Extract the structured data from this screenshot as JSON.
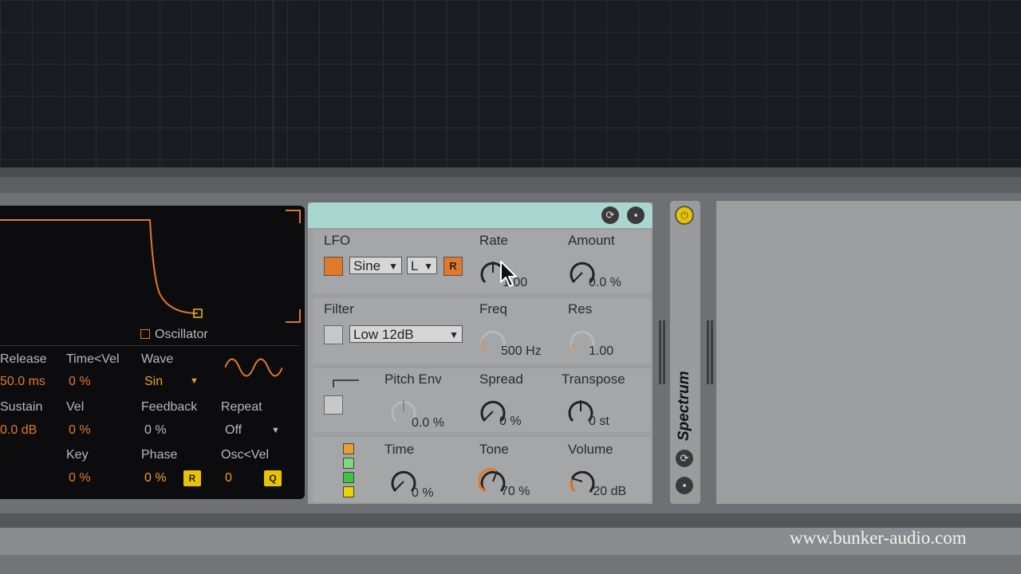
{
  "osc_panel": {
    "osc_label": "Oscillator",
    "release": {
      "label": "Release",
      "value": "50.0 ms"
    },
    "time_vel": {
      "label": "Time<Vel",
      "value": "0 %"
    },
    "wave": {
      "label": "Wave",
      "value": "Sin"
    },
    "sustain": {
      "label": "Sustain",
      "value": "0.0 dB"
    },
    "vel": {
      "label": "Vel",
      "value": "0 %"
    },
    "feedback": {
      "label": "Feedback",
      "value": "0 %"
    },
    "repeat": {
      "label": "Repeat",
      "value": "Off"
    },
    "key": {
      "label": "Key",
      "value": "0 %"
    },
    "phase": {
      "label": "Phase",
      "value": "0 %",
      "btn": "R"
    },
    "osc_vel": {
      "label": "Osc<Vel",
      "value": "0",
      "btn": "Q"
    }
  },
  "lfo": {
    "title": "LFO",
    "wave_select": "Sine",
    "range_select": "L",
    "retrigger": "R",
    "rate": {
      "label": "Rate",
      "value": "1.00"
    },
    "amount": {
      "label": "Amount",
      "value": "0.0 %"
    }
  },
  "filter": {
    "title": "Filter",
    "type_select": "Low 12dB",
    "freq": {
      "label": "Freq",
      "value": "500 Hz"
    },
    "res": {
      "label": "Res",
      "value": "1.00"
    }
  },
  "pitch": {
    "pitch_env": {
      "label": "Pitch Env",
      "value": "0.0 %"
    },
    "spread": {
      "label": "Spread",
      "value": "0 %"
    },
    "transpose": {
      "label": "Transpose",
      "value": "0 st"
    }
  },
  "global": {
    "time": {
      "label": "Time",
      "value": "0 %"
    },
    "tone": {
      "label": "Tone",
      "value": "70 %"
    },
    "volume": {
      "label": "Volume",
      "value": "-20 dB"
    }
  },
  "spectrum": {
    "title": "Spectrum"
  },
  "watermark": "www.bunker-audio.com",
  "colors": {
    "accent": "#e07a2a",
    "title_bar": "#a9d6cf",
    "yellow": "#e8c400"
  }
}
